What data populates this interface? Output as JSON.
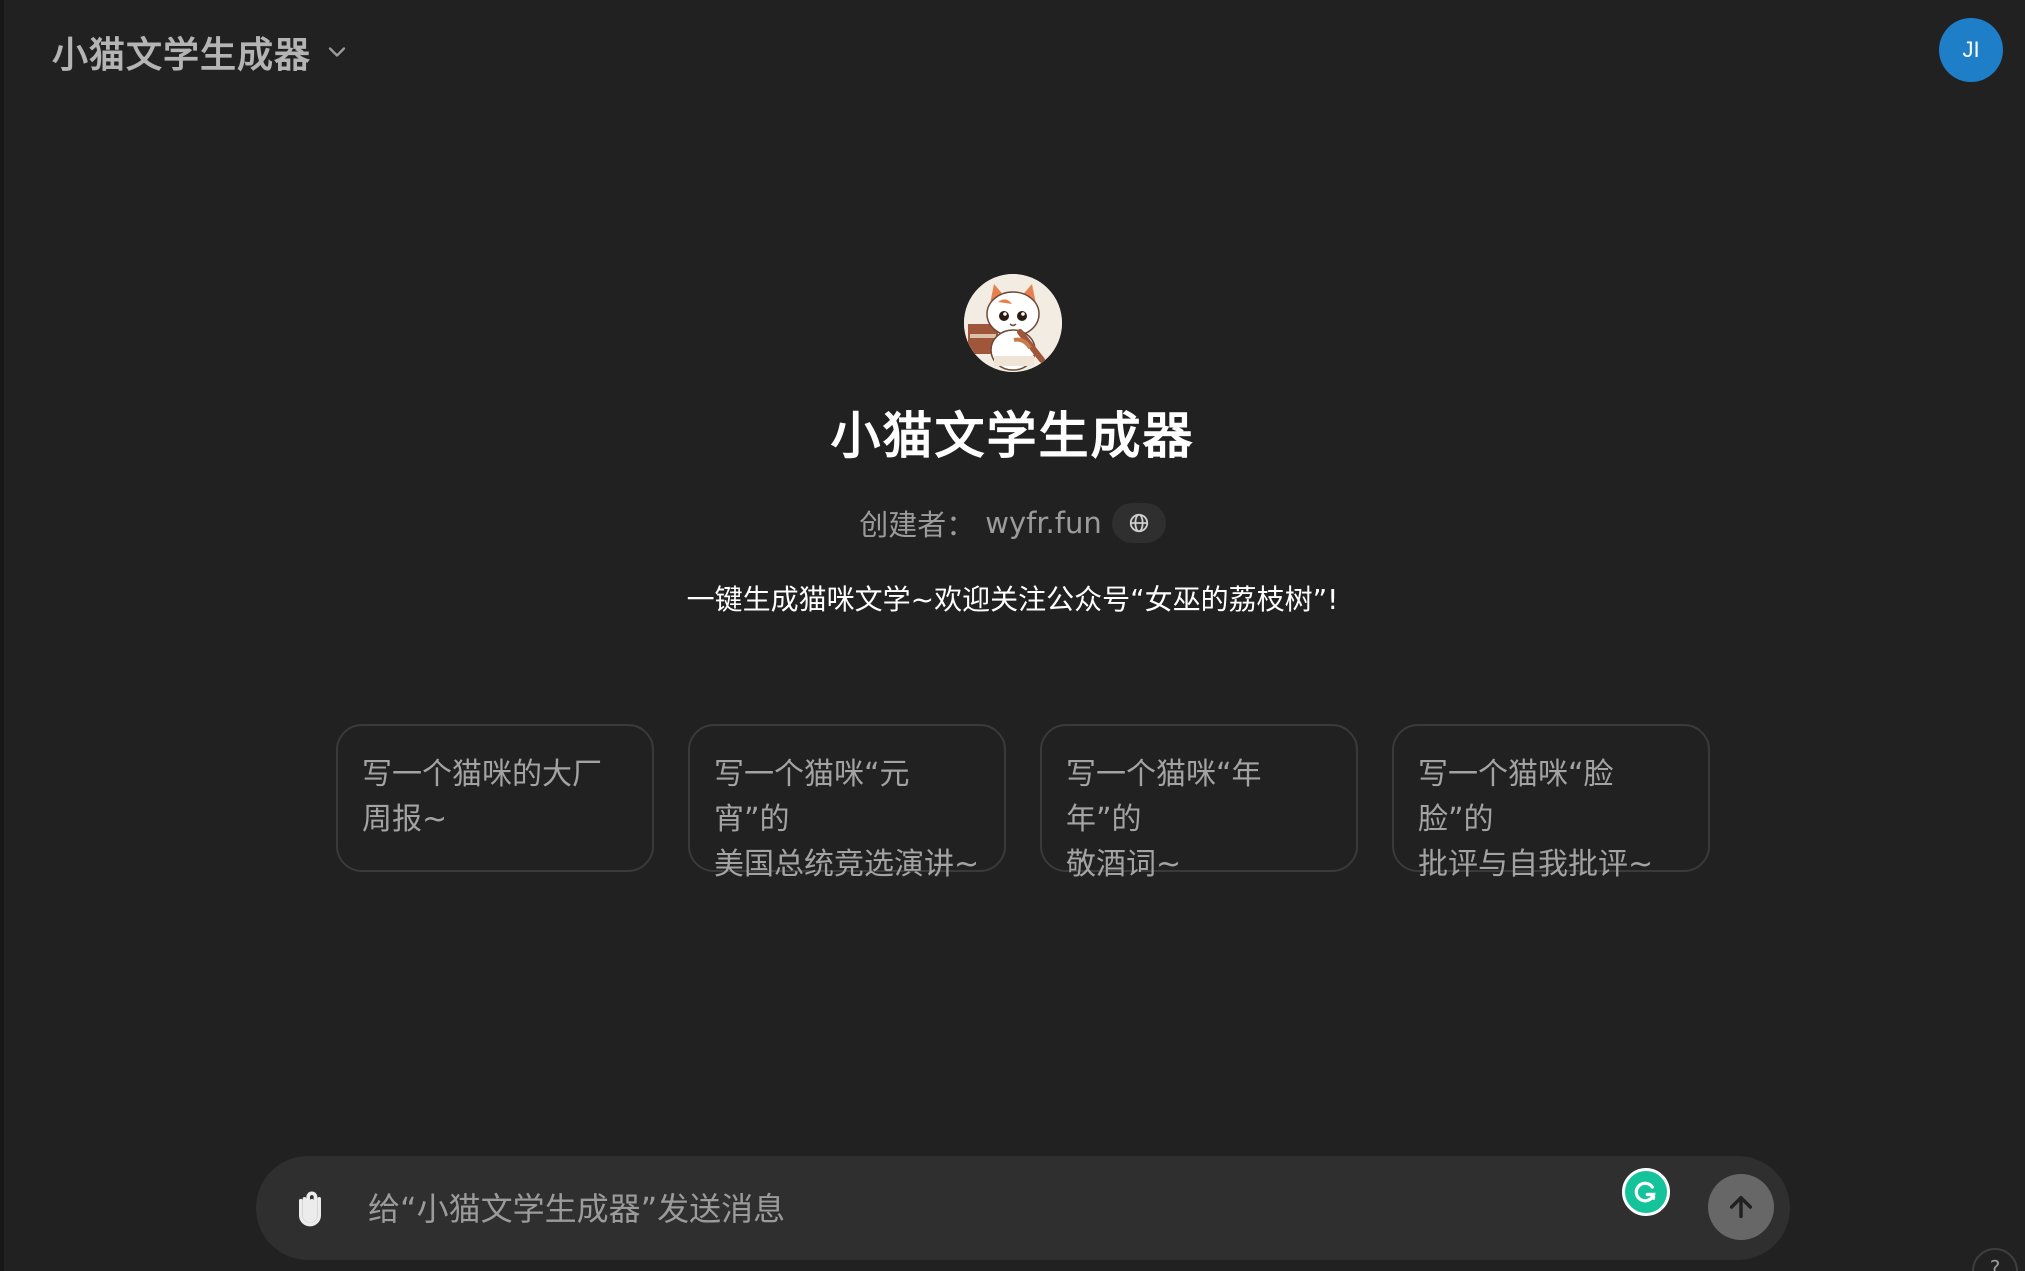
{
  "header": {
    "title": "小猫文学生成器",
    "chevron_icon": "chevron-down-icon"
  },
  "user": {
    "initials": "JI",
    "avatar_color": "#1e7ec8"
  },
  "gpt": {
    "name": "小猫文学生成器",
    "creator_label": "创建者：",
    "creator": "wyfr.fun",
    "globe_icon": "globe-icon",
    "description": "一键生成猫咪文学~欢迎关注公众号“女巫的荔枝树”!"
  },
  "suggestions": [
    {
      "line1": "写一个猫咪的大厂",
      "line2": "周报~"
    },
    {
      "line1": "写一个猫咪“元宵”的",
      "line2": "美国总统竞选演讲~"
    },
    {
      "line1": "写一个猫咪“年年”的",
      "line2": "敬酒词~"
    },
    {
      "line1": "写一个猫咪“脸脸”的",
      "line2": "批评与自我批评~"
    }
  ],
  "composer": {
    "placeholder": "给“小猫文学生成器”发送消息",
    "value": "",
    "attach_icon": "paperclip-icon",
    "send_icon": "arrow-up-icon",
    "grammarly_icon": "grammarly-icon"
  },
  "help": {
    "label": "?"
  },
  "colors": {
    "background": "#212121",
    "composer": "#2f2f2f",
    "card_border": "#3a3a3a",
    "grammarly": "#15c39a",
    "send_disabled": "#676767"
  }
}
